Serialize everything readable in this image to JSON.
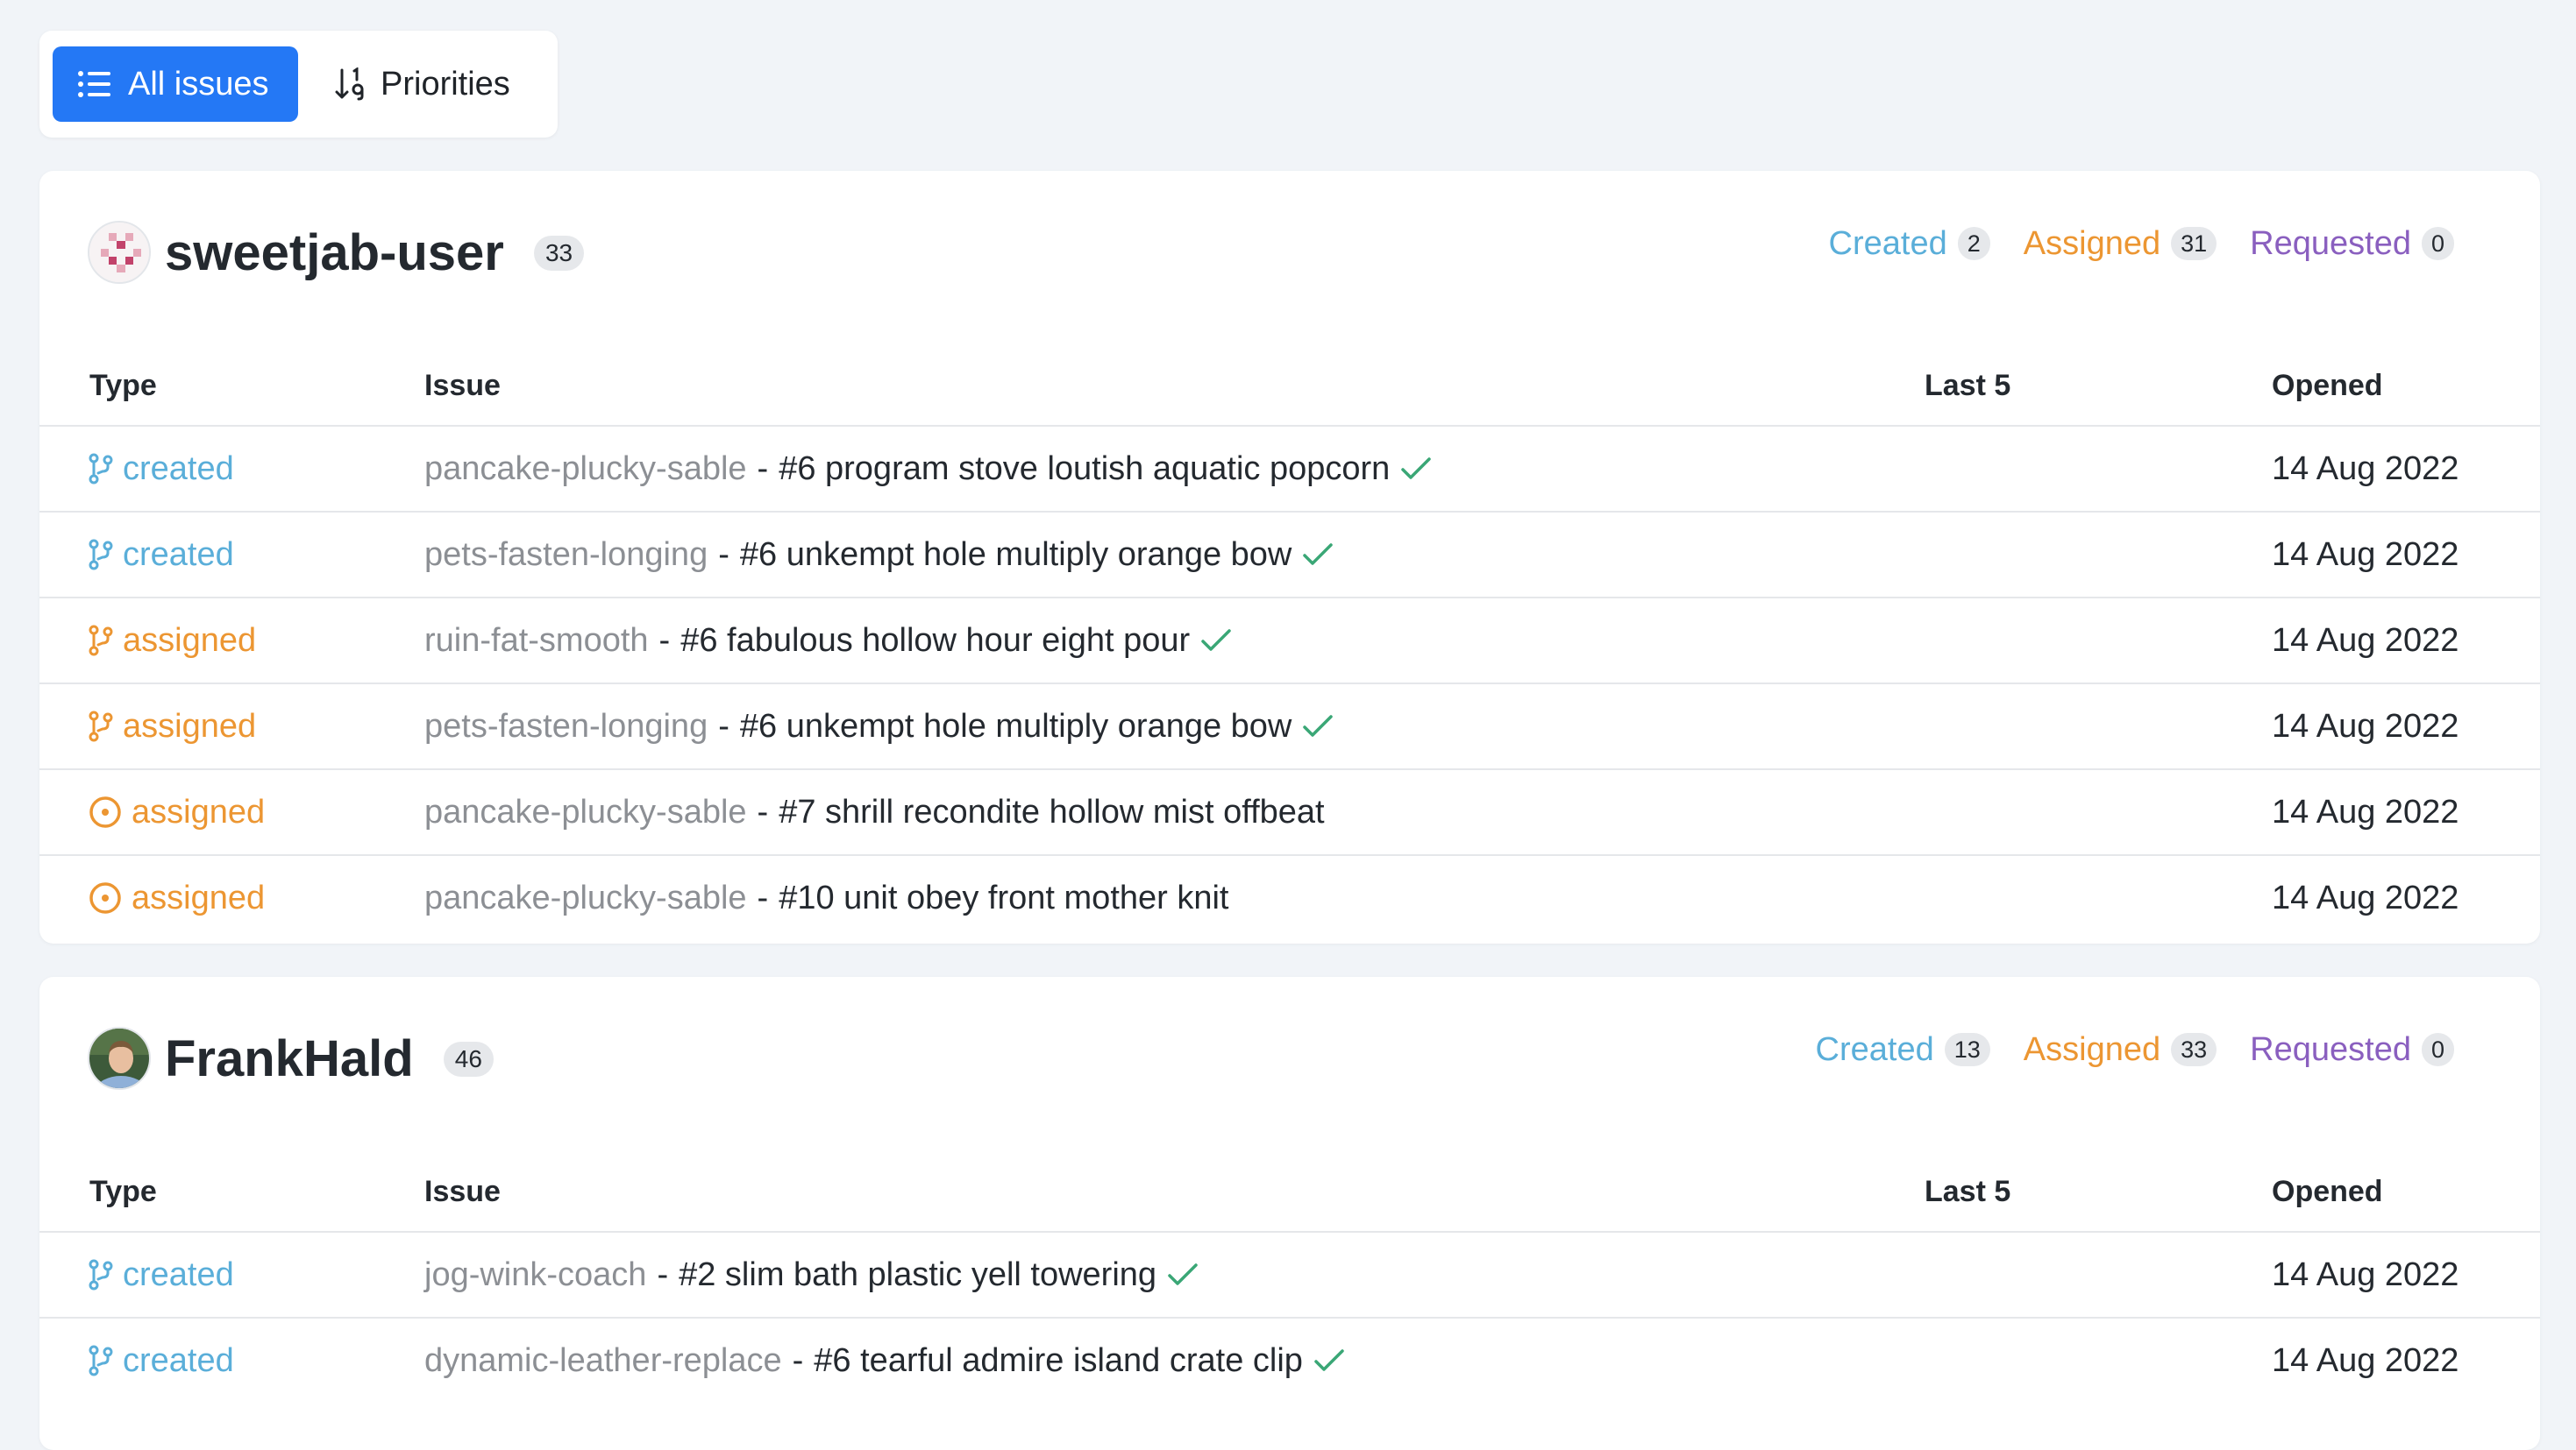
{
  "tabs": [
    {
      "label": "All issues",
      "icon": "list-icon",
      "active": true
    },
    {
      "label": "Priorities",
      "icon": "sort-icon",
      "active": false
    }
  ],
  "colors": {
    "accent": "#2478f5",
    "created": "#5aaed9",
    "assigned": "#ec9632",
    "requested": "#8a5fbf",
    "check": "#3aa776",
    "repo": "#8c8f94"
  },
  "table_headers": {
    "type": "Type",
    "issue": "Issue",
    "last5": "Last 5",
    "opened": "Opened"
  },
  "users": [
    {
      "name": "sweetjab-user",
      "count": "33",
      "avatar": "identicon-avatar",
      "filters": {
        "created_label": "Created",
        "created_count": "2",
        "assigned_label": "Assigned",
        "assigned_count": "31",
        "requested_label": "Requested",
        "requested_count": "0"
      },
      "rows": [
        {
          "type": "created",
          "icon": "pull-request-icon",
          "repo": "pancake-plucky-sable",
          "sep": "-",
          "title": "#6 program stove loutish aquatic popcorn",
          "check": true,
          "opened": "14 Aug 2022"
        },
        {
          "type": "created",
          "icon": "pull-request-icon",
          "repo": "pets-fasten-longing",
          "sep": "-",
          "title": "#6 unkempt hole multiply orange bow",
          "check": true,
          "opened": "14 Aug 2022"
        },
        {
          "type": "assigned",
          "icon": "pull-request-icon",
          "repo": "ruin-fat-smooth",
          "sep": "-",
          "title": "#6 fabulous hollow hour eight pour",
          "check": true,
          "opened": "14 Aug 2022"
        },
        {
          "type": "assigned",
          "icon": "pull-request-icon",
          "repo": "pets-fasten-longing",
          "sep": "-",
          "title": "#6 unkempt hole multiply orange bow",
          "check": true,
          "opened": "14 Aug 2022"
        },
        {
          "type": "assigned",
          "icon": "issue-opened-icon",
          "repo": "pancake-plucky-sable",
          "sep": "-",
          "title": "#7 shrill recondite hollow mist offbeat",
          "check": false,
          "opened": "14 Aug 2022"
        },
        {
          "type": "assigned",
          "icon": "issue-opened-icon",
          "repo": "pancake-plucky-sable",
          "sep": "-",
          "title": "#10 unit obey front mother knit",
          "check": false,
          "opened": "14 Aug 2022"
        }
      ]
    },
    {
      "name": "FrankHald",
      "count": "46",
      "avatar": "photo-avatar",
      "filters": {
        "created_label": "Created",
        "created_count": "13",
        "assigned_label": "Assigned",
        "assigned_count": "33",
        "requested_label": "Requested",
        "requested_count": "0"
      },
      "rows": [
        {
          "type": "created",
          "icon": "pull-request-icon",
          "repo": "jog-wink-coach",
          "sep": "-",
          "title": "#2 slim bath plastic yell towering",
          "check": true,
          "opened": "14 Aug 2022"
        },
        {
          "type": "created",
          "icon": "pull-request-icon",
          "repo": "dynamic-leather-replace",
          "sep": "-",
          "title": "#6 tearful admire island crate clip",
          "check": true,
          "opened": "14 Aug 2022"
        }
      ]
    }
  ]
}
